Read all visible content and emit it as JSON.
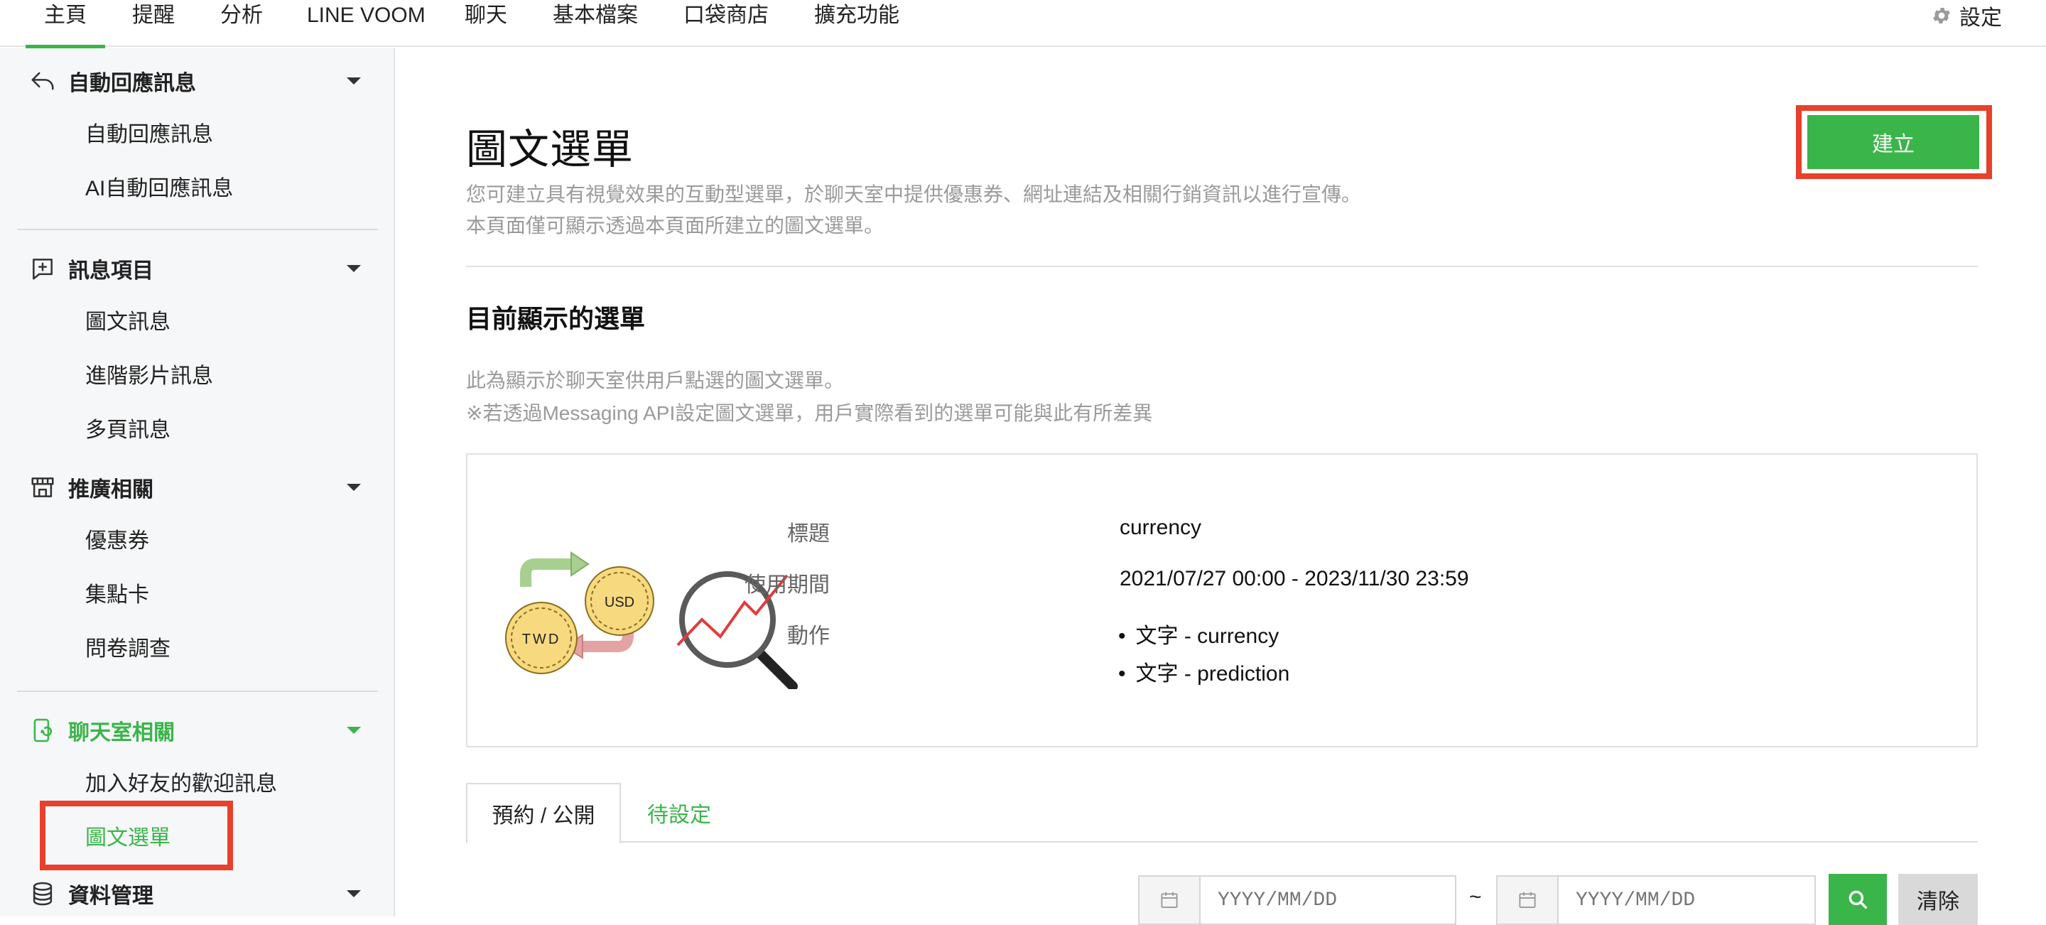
{
  "nav": {
    "tabs": [
      "主頁",
      "提醒",
      "分析",
      "LINE VOOM",
      "聊天",
      "基本檔案",
      "口袋商店",
      "擴充功能"
    ],
    "settings": "設定"
  },
  "sidebar": {
    "groups": [
      {
        "label": "自動回應訊息",
        "icon": "reply-icon",
        "items": [
          "自動回應訊息",
          "AI自動回應訊息"
        ]
      },
      {
        "label": "訊息項目",
        "icon": "message-plus-icon",
        "items": [
          "圖文訊息",
          "進階影片訊息",
          "多頁訊息"
        ]
      },
      {
        "label": "推廣相關",
        "icon": "store-icon",
        "items": [
          "優惠券",
          "集點卡",
          "問卷調查"
        ]
      },
      {
        "label": "聊天室相關",
        "icon": "phone-chat-icon",
        "items": [
          "加入好友的歡迎訊息",
          "圖文選單"
        ]
      },
      {
        "label": "資料管理",
        "icon": "database-icon",
        "items": []
      }
    ],
    "active_item": "圖文選單",
    "accent": "#3ab54a"
  },
  "main": {
    "title": "圖文選單",
    "create_label": "建立",
    "desc_line1": "您可建立具有視覺效果的互動型選單，於聊天室中提供優惠券、網址連結及相關行銷資訊以進行宣傳。",
    "desc_line2": "本頁面僅可顯示透過本頁面所建立的圖文選單。",
    "current_heading": "目前顯示的選單",
    "current_desc1": "此為顯示於聊天室供用戶點選的圖文選單。",
    "current_desc2": "※若透過Messaging API設定圖文選單，用戶實際看到的選單可能與此有所差異",
    "card": {
      "illus_twd": "TWD",
      "illus_usd": "USD",
      "title_label": "標題",
      "title_value": "currency",
      "period_label": "使用期間",
      "period_value": "2021/07/27 00:00 - 2023/11/30 23:59",
      "action_label": "動作",
      "actions": [
        "文字 - currency",
        "文字 - prediction"
      ]
    },
    "tabs": [
      "預約 / 公開",
      "待設定"
    ],
    "date_placeholder": "YYYY/MM/DD",
    "tilde": "~",
    "clear_label": "清除"
  }
}
